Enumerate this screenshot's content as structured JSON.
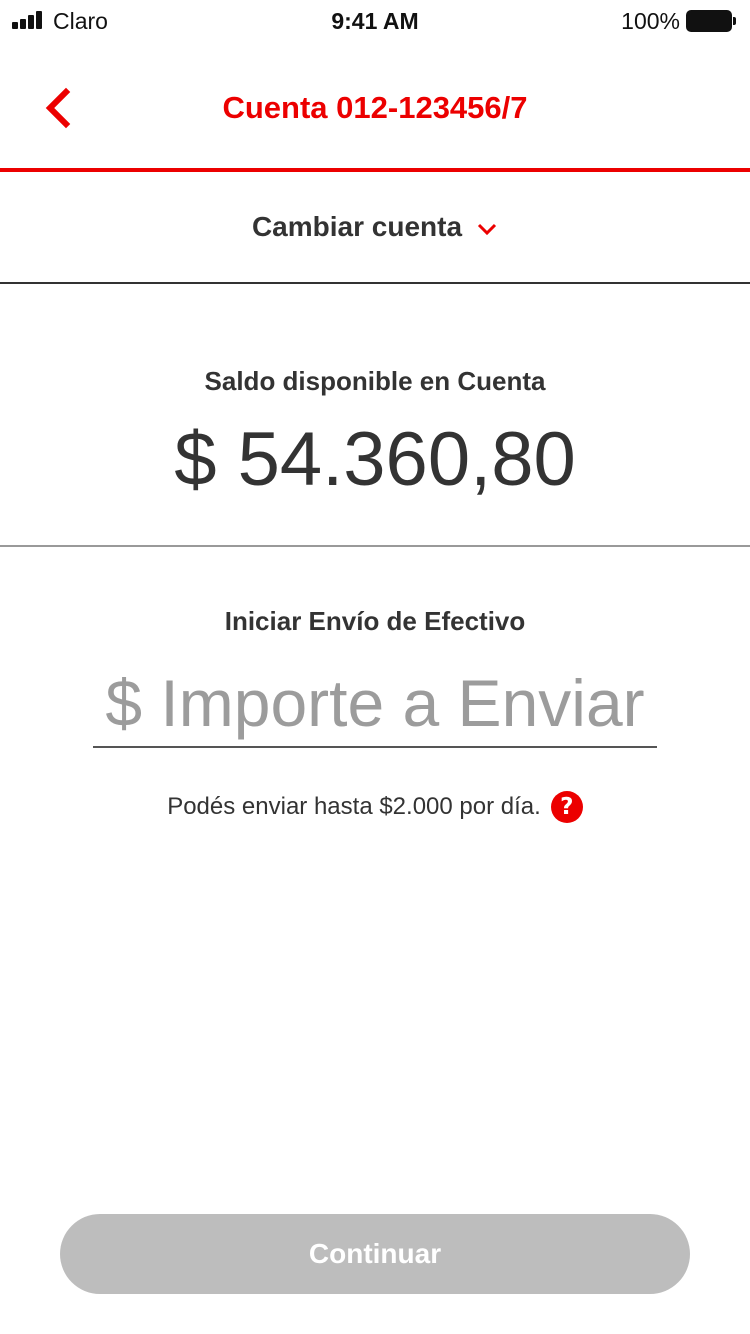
{
  "status_bar": {
    "carrier": "Claro",
    "time": "9:41 AM",
    "battery_percent": "100%"
  },
  "header": {
    "title": "Cuenta 012-123456/7",
    "back_icon": "chevron-left-icon"
  },
  "account_selector": {
    "label": "Cambiar cuenta",
    "icon": "chevron-down-icon"
  },
  "balance": {
    "label": "Saldo disponible en Cuenta",
    "amount": "$ 54.360,80"
  },
  "send": {
    "label": "Iniciar Envío de Efectivo",
    "amount_value": "",
    "amount_placeholder": "$ Importe a Enviar",
    "limit_text": "Podés enviar hasta $2.000 por día.",
    "help_icon": "question-icon",
    "help_glyph": "?"
  },
  "actions": {
    "continue_label": "Continuar",
    "continue_enabled": false
  },
  "colors": {
    "brand": "#ec0000",
    "text": "#333333",
    "disabled_button": "#bdbdbd"
  }
}
